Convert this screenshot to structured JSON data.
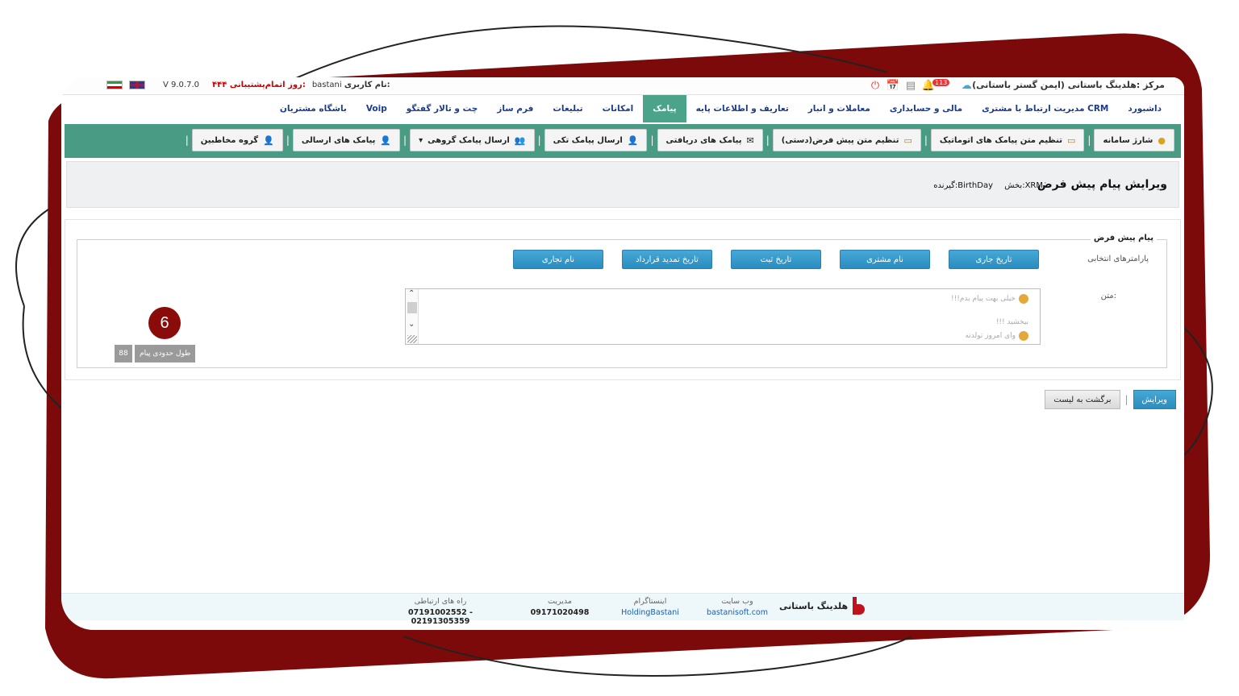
{
  "topbar": {
    "version": "V 9.0.7.0",
    "support_label": "اتمام‌پشتیبانی:",
    "support_value": "۴۴۴ روز",
    "username_label": "نام کاربری:",
    "username_value": "bastani",
    "center_title": "مرکز :هلدینگ باستانی (ایمن گستر باستانی)",
    "notification_count": "113"
  },
  "main_menu": [
    "داشبورد",
    "مدیریت ارتباط با مشتری CRM",
    "مالی و حسابداری",
    "معاملات و انبار",
    "تعاریف و اطلاعات پایه",
    "پیامک",
    "امکانات",
    "تبلیغات",
    "فرم ساز",
    "چت و تالار گفتگو",
    "Voip",
    "باشگاه مشتریان"
  ],
  "sub_menu": [
    "شارژ سامانه",
    "تنظیم متن پیامک های اتوماتیک",
    "تنظیم متن پیش فرض(دستی)",
    "پیامک های دریافتی",
    "ارسال پیامک تکی",
    "ارسال پیامک گروهی",
    "پیامک های ارسالی",
    "گروه مخاطبین"
  ],
  "page": {
    "title": "ویرایش پیام پیش فرض",
    "section": "بخش:XRM",
    "receiver": "گیرنده:BirthDay"
  },
  "form": {
    "legend": "پیام پیش فرض",
    "params_label": "پارامترهای انتخابی",
    "params": [
      "تاریخ جاری",
      "نام مشتری",
      "تاریخ ثبت",
      "تاریخ تمدید قرارداد",
      "نام تجاری"
    ],
    "text_label": "متن:",
    "text_lines": [
      "خیلی بهت پیام بدم!!!",
      "بیخشید !!!",
      "وای امروز تولدته"
    ],
    "length_label": "طول حدودی پیام",
    "length_value": "88",
    "step_number": "6"
  },
  "actions": {
    "edit": "ویرایش",
    "back": "برگشت به لیست"
  },
  "footer": {
    "brand": "هلدینگ باستانی",
    "website_label": "وب سایت",
    "website_value": "bastanisoft.com",
    "instagram_label": "اینستاگرام",
    "instagram_value": "HoldingBastani",
    "management_label": "مدیریت",
    "management_value": "09171020498",
    "contact_label": "راه های ارتباطی",
    "contact_value": "07191002552 - 02191305359"
  },
  "colors": {
    "frame": "#7d0a0a",
    "menu_active": "#4ba38a",
    "submenu_bg": "#4a9b84",
    "param_button": "#2a8dc0"
  }
}
